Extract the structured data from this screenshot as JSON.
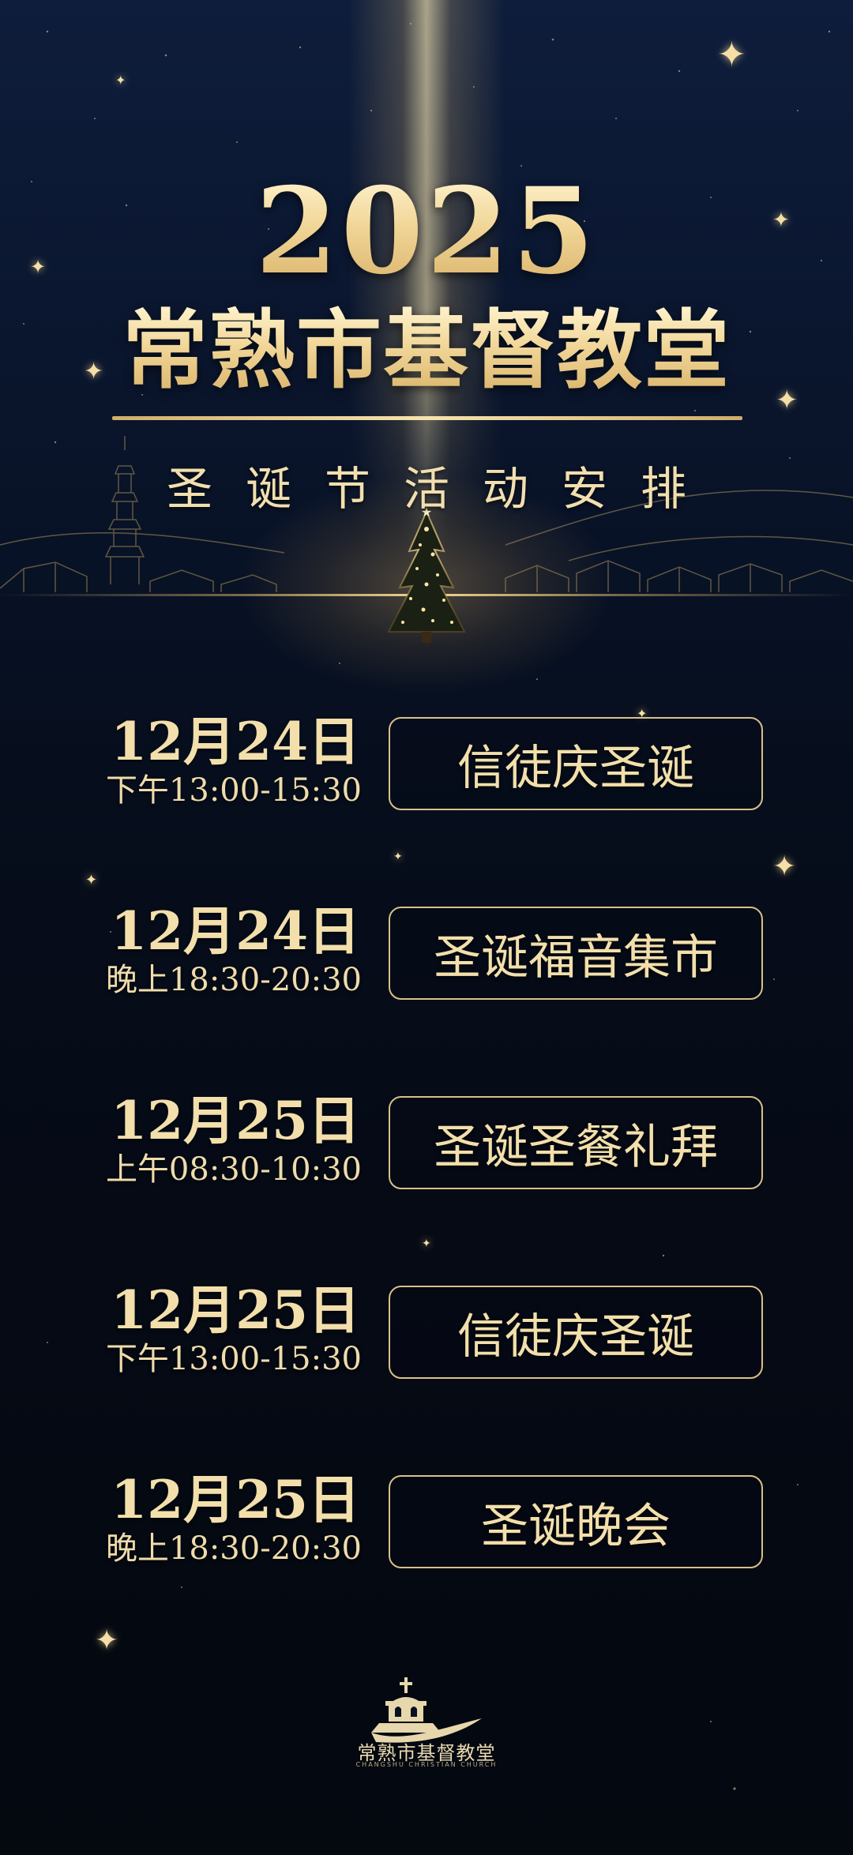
{
  "header": {
    "year": "2025",
    "church_name": "常熟市基督教堂",
    "subtitle": "圣诞节活动安排"
  },
  "events": [
    {
      "date": "12月24日",
      "time": "下午13:00-15:30",
      "name": "信徒庆圣诞"
    },
    {
      "date": "12月24日",
      "time": "晚上18:30-20:30",
      "name": "圣诞福音集市"
    },
    {
      "date": "12月25日",
      "time": "上午08:30-10:30",
      "name": "圣诞圣餐礼拜"
    },
    {
      "date": "12月25日",
      "time": "下午13:00-15:30",
      "name": "信徒庆圣诞"
    },
    {
      "date": "12月25日",
      "time": "晚上18:30-20:30",
      "name": "圣诞晚会"
    }
  ],
  "logo": {
    "name": "常熟市基督教堂",
    "english": "CHANGSHU CHRISTIAN CHURCH",
    "icon": "church-icon"
  },
  "colors": {
    "gold": "#f2dfab",
    "border": "#d8c08a",
    "background": "#050a15",
    "sky": "#0e1d3c"
  }
}
